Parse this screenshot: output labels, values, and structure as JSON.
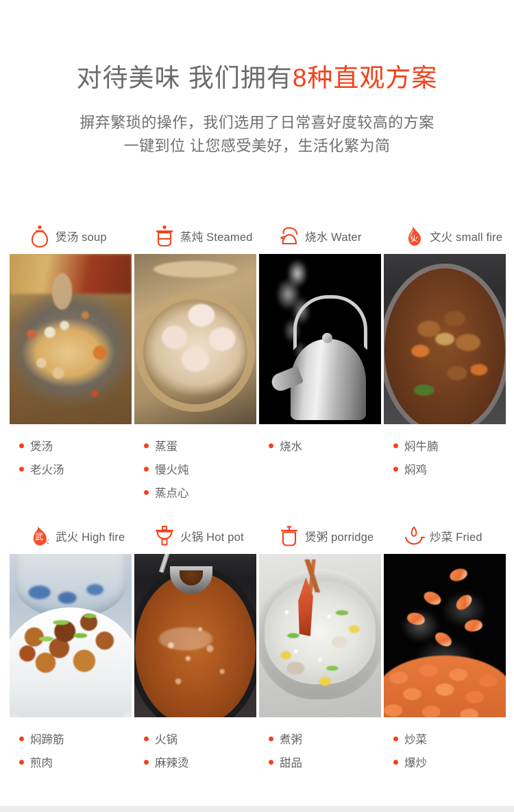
{
  "header": {
    "headline_plain": "对待美味 我们拥有",
    "headline_accent": "8种直观方案",
    "subline_1": "摒弃繁琐的操作，我们选用了日常喜好度较高的方案",
    "subline_2": "一键到位 让您感受美好，生活化繁为简"
  },
  "colors": {
    "accent": "#f4401a",
    "headline_text": "#6b6b6b",
    "body_text": "#636363",
    "background": "#ffffff",
    "bottom_strip": "#ececec"
  },
  "modes": [
    {
      "icon": "soup-pot-icon",
      "label": "煲汤 soup",
      "photo": "chicken-soup-in-clay-pot-photo",
      "tags": [
        "煲汤",
        "老火汤"
      ]
    },
    {
      "icon": "steamer-pot-icon",
      "label": "蒸炖 Steamed",
      "photo": "har-gow-dumplings-in-bamboo-steamer-photo",
      "tags": [
        "蒸蛋",
        "慢火炖",
        "蒸点心"
      ]
    },
    {
      "icon": "kettle-icon",
      "label": "烧水 Water",
      "photo": "steaming-steel-kettle-photo",
      "tags": [
        "烧水"
      ]
    },
    {
      "icon": "small-flame-icon",
      "label": "文火 small fire",
      "photo": "braised-beef-brisket-photo",
      "tags": [
        "焖牛腩",
        "焖鸡"
      ]
    },
    {
      "icon": "high-flame-icon",
      "label": "武火 High fire",
      "photo": "braised-pork-with-chestnuts-photo",
      "tags": [
        "焖蹄筋",
        "煎肉"
      ]
    },
    {
      "icon": "hotpot-icon",
      "label": "火锅 Hot pot",
      "photo": "hot-pot-with-ladle-photo",
      "tags": [
        "火锅",
        "麻辣烫"
      ]
    },
    {
      "icon": "porridge-pot-icon",
      "label": "煲粥 porridge",
      "photo": "seafood-congee-with-crab-photo",
      "tags": [
        "煮粥",
        "甜品"
      ]
    },
    {
      "icon": "wok-fried-icon",
      "label": "炒菜 Fried",
      "photo": "stir-fried-shrimp-in-smoke-photo",
      "tags": [
        "炒菜",
        "爆炒"
      ]
    }
  ]
}
